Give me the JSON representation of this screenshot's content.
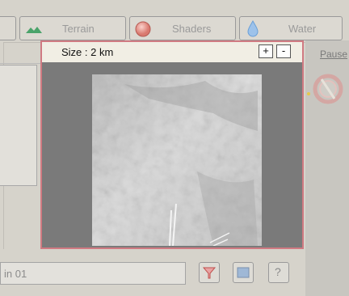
{
  "tabs": {
    "terrain_label": "Terrain",
    "shaders_label": "Shaders",
    "water_label": "Water"
  },
  "side": {
    "pause_label": "Pause"
  },
  "popup": {
    "size_label": "Size : 2 km",
    "plus_label": "+",
    "minus_label": "-"
  },
  "bottom": {
    "name_value": "in 01",
    "help_label": "?"
  },
  "colors": {
    "popup_border": "#d07a82",
    "shaders_icon": "#d9796f",
    "water_icon": "#6aa0d8",
    "terrain_icon": "#4aa36a"
  }
}
